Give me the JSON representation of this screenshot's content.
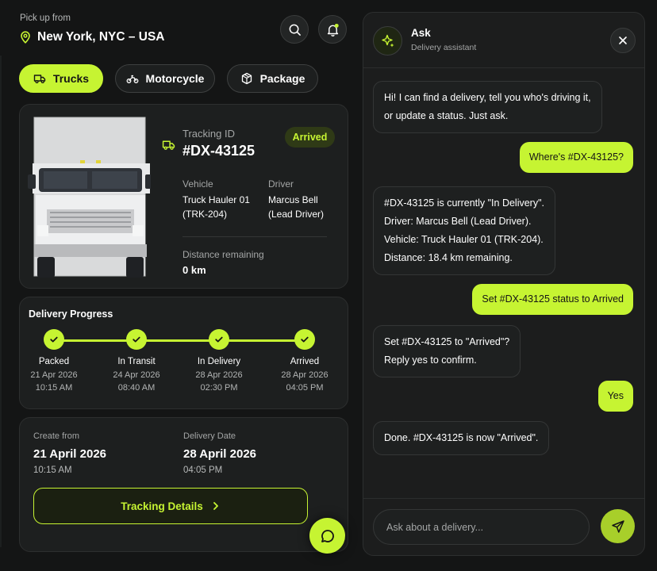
{
  "pickup": {
    "label": "Pick up from",
    "location": "New York, NYC – USA"
  },
  "modes": [
    {
      "label": "Trucks",
      "icon": "truck-icon",
      "active": true
    },
    {
      "label": "Motorcycle",
      "icon": "motorcycle-icon",
      "active": false
    },
    {
      "label": "Package",
      "icon": "package-icon",
      "active": false
    }
  ],
  "shipment": {
    "tracking_label": "Tracking ID",
    "tracking_id": "#DX-43125",
    "status": "Arrived",
    "vehicle_label": "Vehicle",
    "vehicle_name": "Truck Hauler 01",
    "vehicle_code": "(TRK-204)",
    "driver_label": "Driver",
    "driver_name": "Marcus Bell",
    "driver_role": "(Lead Driver)",
    "distance_label": "Distance remaining",
    "distance_value": "0 km"
  },
  "progress": {
    "title": "Delivery Progress",
    "steps": [
      {
        "name": "Packed",
        "date": "21 Apr 2026",
        "time": "10:15 AM"
      },
      {
        "name": "In Transit",
        "date": "24 Apr 2026",
        "time": "08:40 AM"
      },
      {
        "name": "In Delivery",
        "date": "28 Apr 2026",
        "time": "02:30 PM"
      },
      {
        "name": "Arrived",
        "date": "28 Apr 2026",
        "time": "04:05 PM"
      }
    ]
  },
  "dates": {
    "create_label": "Create from",
    "create_date": "21 April 2026",
    "create_time": "10:15 AM",
    "delivery_label": "Delivery Date",
    "delivery_date": "28 April 2026",
    "delivery_time": "04:05 PM",
    "details_button": "Tracking Details"
  },
  "chat": {
    "title": "Ask",
    "subtitle": "Delivery assistant",
    "input_placeholder": "Ask about a delivery...",
    "messages": [
      {
        "from": "bot",
        "lines": [
          "Hi! I can find a delivery, tell you who's driving it,",
          "or update a status. Just ask."
        ]
      },
      {
        "from": "user",
        "lines": [
          "Where's #DX-43125?"
        ]
      },
      {
        "from": "bot",
        "lines": [
          "#DX-43125 is currently \"In Delivery\".",
          "Driver: Marcus Bell (Lead Driver).",
          "Vehicle: Truck Hauler 01 (TRK-204).",
          "Distance: 18.4 km remaining."
        ]
      },
      {
        "from": "user",
        "lines": [
          "Set #DX-43125 status to Arrived"
        ]
      },
      {
        "from": "bot",
        "lines": [
          "Set #DX-43125 to \"Arrived\"?",
          "Reply yes to confirm."
        ]
      },
      {
        "from": "user",
        "lines": [
          "Yes"
        ]
      },
      {
        "from": "bot",
        "lines": [
          "Done. #DX-43125 is now \"Arrived\"."
        ]
      }
    ]
  },
  "colors": {
    "accent": "#c6f432",
    "background": "#141515",
    "card": "#1d1f1f"
  }
}
